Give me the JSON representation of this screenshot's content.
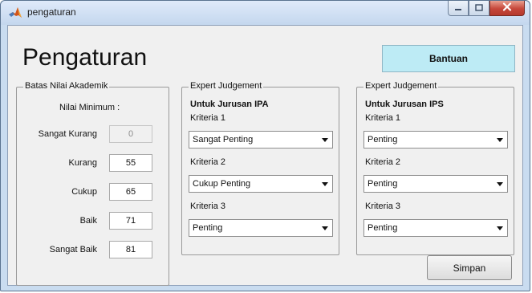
{
  "window": {
    "title": "pengaturan",
    "icons": {
      "app": "matlab-logo-icon",
      "minimize": "minimize-icon",
      "maximize": "maximize-icon",
      "close": "close-icon"
    }
  },
  "main": {
    "heading": "Pengaturan",
    "help_label": "Bantuan",
    "save_label": "Simpan"
  },
  "academic": {
    "legend": "Batas Nilai Akademik",
    "caption": "Nilai Minimum :",
    "rows": [
      {
        "label": "Sangat Kurang",
        "value": "0"
      },
      {
        "label": "Kurang",
        "value": "55"
      },
      {
        "label": "Cukup",
        "value": "65"
      },
      {
        "label": "Baik",
        "value": "71"
      },
      {
        "label": "Sangat Baik",
        "value": "81"
      }
    ]
  },
  "ipa": {
    "legend": "Expert Judgement",
    "heading": "Untuk Jurusan IPA",
    "criteria": [
      {
        "label": "Kriteria 1",
        "selected": "Sangat Penting"
      },
      {
        "label": "Kriteria 2",
        "selected": "Cukup Penting"
      },
      {
        "label": "Kriteria 3",
        "selected": "Penting"
      }
    ]
  },
  "ips": {
    "legend": "Expert Judgement",
    "heading": "Untuk Jurusan IPS",
    "criteria": [
      {
        "label": "Kriteria 1",
        "selected": "Penting"
      },
      {
        "label": "Kriteria 2",
        "selected": "Penting"
      },
      {
        "label": "Kriteria 3",
        "selected": "Penting"
      }
    ]
  },
  "colors": {
    "help_button": "#bdebf5",
    "window_frame": "#c9dcf0",
    "close_button": "#c6473a",
    "client_background": "#f0f0f0"
  }
}
